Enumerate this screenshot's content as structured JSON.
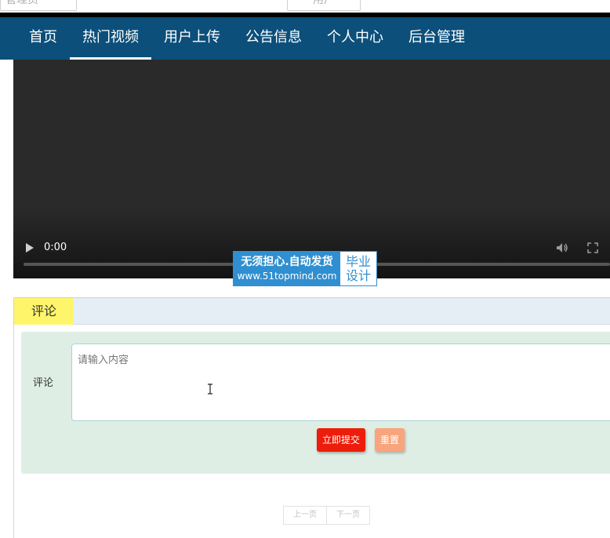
{
  "top_strip": {
    "field_1": "管理员",
    "field_2": "用户"
  },
  "nav": {
    "items": [
      {
        "label": "首页",
        "active": false
      },
      {
        "label": "热门视频",
        "active": true
      },
      {
        "label": "用户上传",
        "active": false
      },
      {
        "label": "公告信息",
        "active": false
      },
      {
        "label": "个人中心",
        "active": false
      },
      {
        "label": "后台管理",
        "active": false
      }
    ]
  },
  "video": {
    "time": "0:00",
    "progress": 0,
    "icons": [
      "play-icon",
      "volume-icon",
      "fullscreen-icon"
    ]
  },
  "watermark": {
    "line1": "无须担心.自动发货",
    "line2": "www.51topmind.com",
    "side_line1": "毕业",
    "side_line2": "设计"
  },
  "comment": {
    "tab_label": "评论",
    "field_label": "评论",
    "placeholder": "请输入内容",
    "value": "",
    "submit_label": "立即提交",
    "reset_label": "重置"
  },
  "pager": {
    "prev_label": "上一页",
    "next_label": "下一页"
  },
  "colors": {
    "nav_bg": "#0c4f7a",
    "tab_bg": "#fff56b",
    "form_bg": "#deeee5",
    "submit_bg": "#ee1c0a",
    "reset_bg": "#f8a57d",
    "watermark_blue": "#2f8fd0"
  }
}
